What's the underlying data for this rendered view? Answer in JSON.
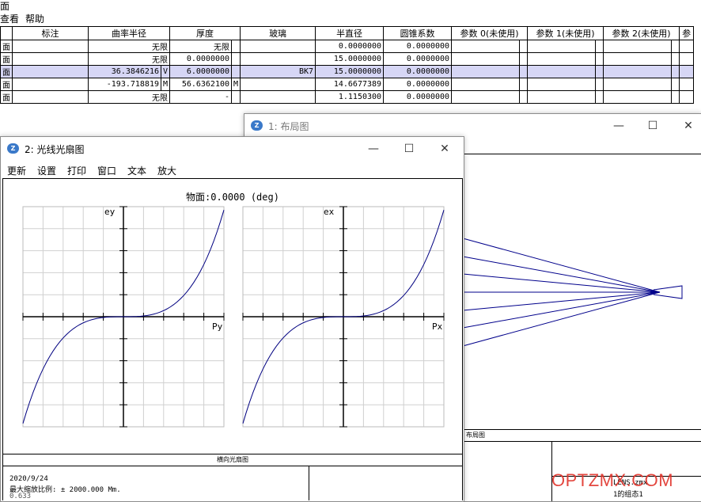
{
  "menu": {
    "view": "查看",
    "help": "帮助",
    "prefix": "面"
  },
  "lde": {
    "headers": [
      "标注",
      "曲率半径",
      "厚度",
      "玻璃",
      "半直径",
      "圆锥系数",
      "参数 0(未使用)",
      "参数 1(未使用)",
      "参数 2(未使用)",
      "参"
    ],
    "rows": [
      {
        "label": "面",
        "radius": "无限",
        "rflag": "",
        "thick": "无限",
        "tflag": "",
        "glass": "",
        "semi": "0.0000000",
        "conic": "0.0000000"
      },
      {
        "label": "面",
        "radius": "无限",
        "rflag": "",
        "thick": "0.0000000",
        "tflag": "",
        "glass": "",
        "semi": "15.0000000",
        "conic": "0.0000000"
      },
      {
        "label": "面",
        "radius": "36.3846216",
        "rflag": "V",
        "thick": "6.0000000",
        "tflag": "",
        "glass": "BK7",
        "semi": "15.0000000",
        "conic": "0.0000000"
      },
      {
        "label": "面",
        "radius": "-193.718819",
        "rflag": "M",
        "thick": "56.6362100",
        "tflag": "M",
        "glass": "",
        "semi": "14.6677389",
        "conic": "0.0000000"
      },
      {
        "label": "面",
        "radius": "无限",
        "rflag": "",
        "thick": "-",
        "tflag": "",
        "glass": "",
        "semi": "1.1150300",
        "conic": "0.0000000"
      }
    ]
  },
  "layout_window": {
    "title": "1: 布局图",
    "footer_label": "布局图",
    "file": "LENS.zmx",
    "config": "1的组态1",
    "watermark": "OPTZMX.COM",
    "accent": "#e0322a",
    "ray_color": "#00008b"
  },
  "fan_window": {
    "title": "2: 光线光扇图",
    "menu": [
      "更新",
      "设置",
      "打印",
      "窗口",
      "文本",
      "放大"
    ],
    "plot_title": "物面:0.0000 (deg)",
    "left": {
      "ylabel": "ey",
      "xlabel": "Py"
    },
    "right": {
      "ylabel": "ex",
      "xlabel": "Px"
    },
    "footer_label": "横向光扇图",
    "date": "2020/9/24",
    "scale": "最大缩放比例: ± 2000.000 Μm.",
    "wavelength": "0.633"
  }
}
